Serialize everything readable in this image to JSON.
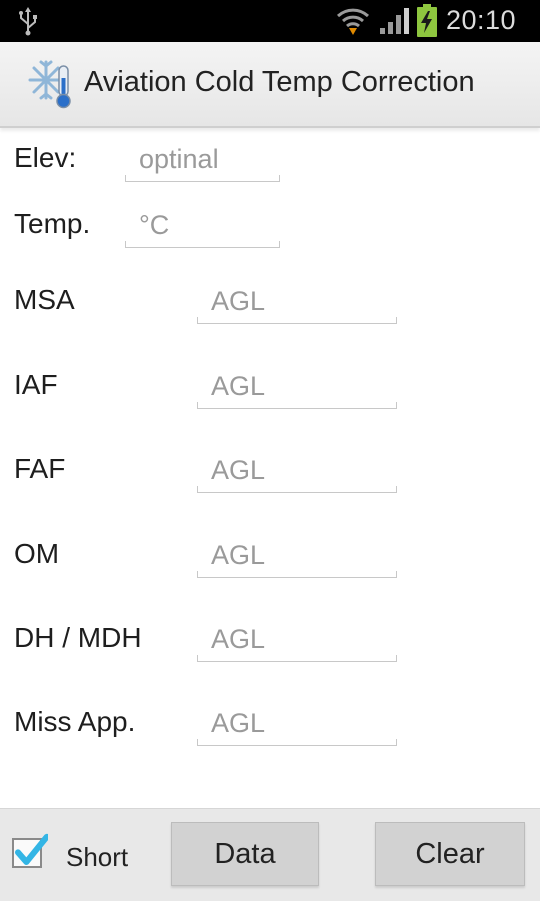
{
  "status_bar": {
    "time": "20:10"
  },
  "action_bar": {
    "title": "Aviation Cold Temp Correction"
  },
  "top_fields": [
    {
      "label": "Elev:",
      "placeholder": "optinal"
    },
    {
      "label": "Temp.",
      "placeholder": "°C"
    }
  ],
  "altitude_fields": [
    {
      "label": "MSA",
      "placeholder": "AGL"
    },
    {
      "label": "IAF",
      "placeholder": "AGL"
    },
    {
      "label": "FAF",
      "placeholder": "AGL"
    },
    {
      "label": "OM",
      "placeholder": "AGL"
    },
    {
      "label": "DH / MDH",
      "placeholder": "AGL"
    },
    {
      "label": "Miss App.",
      "placeholder": "AGL"
    }
  ],
  "bottom_bar": {
    "short_checkbox": {
      "label": "Short",
      "checked": true
    },
    "data_button": "Data",
    "clear_button": "Clear"
  },
  "colors": {
    "check_accent": "#33b5e5",
    "battery": "#8ec63f"
  }
}
